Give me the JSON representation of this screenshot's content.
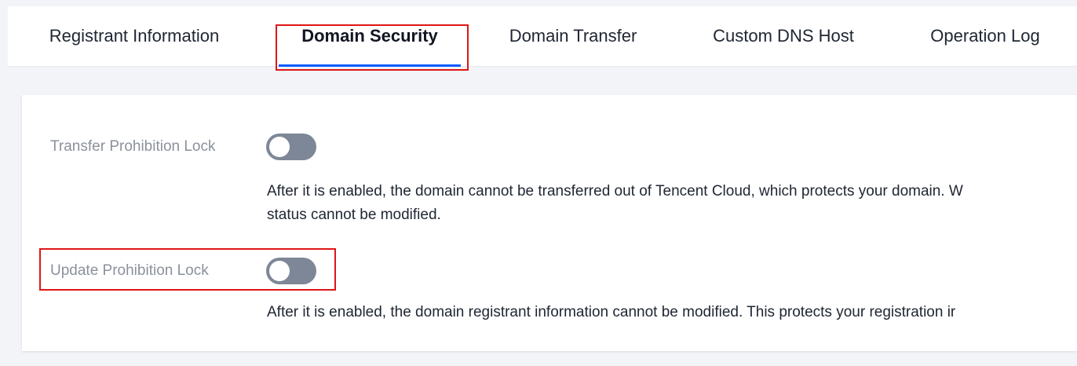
{
  "tabs": [
    {
      "label": "Registrant Information",
      "active": false
    },
    {
      "label": "Domain Security",
      "active": true
    },
    {
      "label": "Domain Transfer",
      "active": false
    },
    {
      "label": "Custom DNS Host",
      "active": false
    },
    {
      "label": "Operation Log",
      "active": false
    }
  ],
  "settings": {
    "transfer_lock": {
      "label": "Transfer Prohibition Lock",
      "enabled": false,
      "description_line1": "After it is enabled, the domain cannot be transferred out of Tencent Cloud, which protects your domain. W",
      "description_line2": "status cannot be modified."
    },
    "update_lock": {
      "label": "Update Prohibition Lock",
      "enabled": false,
      "description_line1": "After it is enabled, the domain registrant information cannot be modified. This protects your registration ir"
    }
  },
  "colors": {
    "accent": "#0a5bff",
    "highlight_box": "#e01515",
    "toggle_off": "#7d8797"
  }
}
